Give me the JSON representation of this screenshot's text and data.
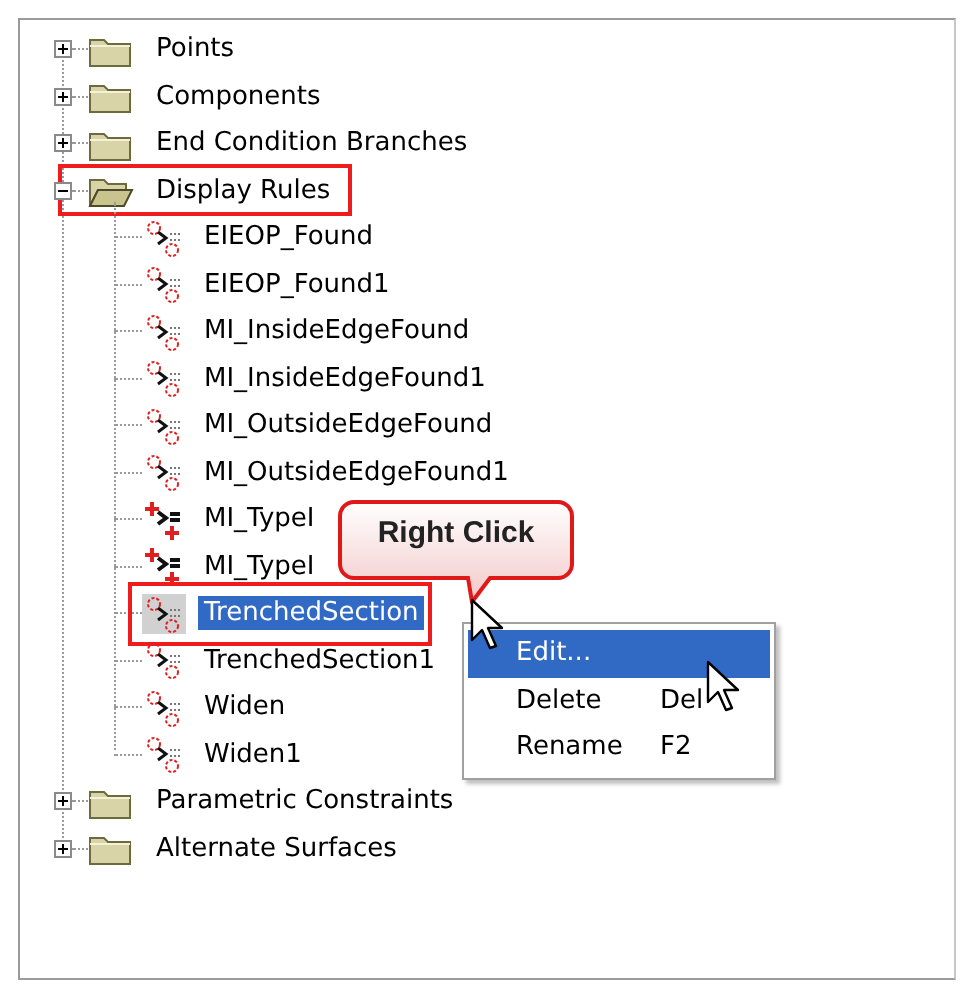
{
  "tree": [
    {
      "label": "Points",
      "kind": "folder",
      "expanded": false,
      "selected": false,
      "highlighted": false
    },
    {
      "label": "Components",
      "kind": "folder",
      "expanded": false,
      "selected": false,
      "highlighted": false
    },
    {
      "label": "End Condition Branches",
      "kind": "folder",
      "expanded": false,
      "selected": false,
      "highlighted": false
    },
    {
      "label": "Display Rules",
      "kind": "folder",
      "expanded": true,
      "selected": false,
      "highlighted": true,
      "children": [
        {
          "label": "EIEOP_Found",
          "kind": "rule",
          "selected": false,
          "highlighted": false
        },
        {
          "label": "EIEOP_Found1",
          "kind": "rule",
          "selected": false,
          "highlighted": false
        },
        {
          "label": "MI_InsideEdgeFound",
          "kind": "rule",
          "selected": false,
          "highlighted": false
        },
        {
          "label": "MI_InsideEdgeFound1",
          "kind": "rule",
          "selected": false,
          "highlighted": false
        },
        {
          "label": "MI_OutsideEdgeFound",
          "kind": "rule",
          "selected": false,
          "highlighted": false
        },
        {
          "label": "MI_OutsideEdgeFound1",
          "kind": "rule",
          "selected": false,
          "highlighted": false
        },
        {
          "label": "MI_TypeI",
          "kind": "typerule",
          "selected": false,
          "highlighted": false
        },
        {
          "label": "MI_TypeI",
          "kind": "typerule",
          "selected": false,
          "highlighted": false
        },
        {
          "label": "TrenchedSection",
          "kind": "rule",
          "selected": true,
          "highlighted": true
        },
        {
          "label": "TrenchedSection1",
          "kind": "rule",
          "selected": false,
          "highlighted": false
        },
        {
          "label": "Widen",
          "kind": "rule",
          "selected": false,
          "highlighted": false
        },
        {
          "label": "Widen1",
          "kind": "rule",
          "selected": false,
          "highlighted": false
        }
      ]
    },
    {
      "label": "Parametric Constraints",
      "kind": "folder",
      "expanded": false,
      "selected": false,
      "highlighted": false
    },
    {
      "label": "Alternate Surfaces",
      "kind": "folder",
      "expanded": false,
      "selected": false,
      "highlighted": false
    }
  ],
  "callout": {
    "text": "Right Click"
  },
  "context_menu": {
    "items": [
      {
        "label": "Edit...",
        "selected": true
      },
      {
        "label": "Delete",
        "shortcut": "Del",
        "selected": false
      },
      {
        "label": "Rename",
        "shortcut": "F2",
        "selected": false
      }
    ]
  }
}
